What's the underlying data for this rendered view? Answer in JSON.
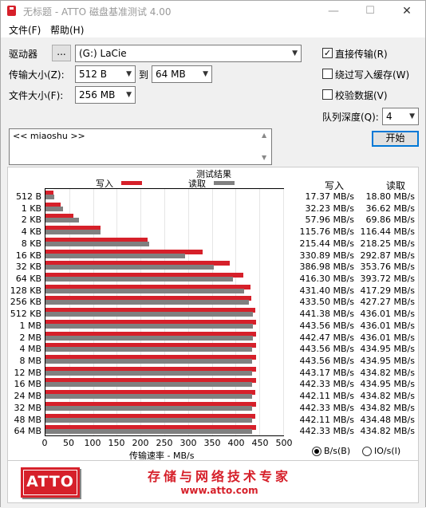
{
  "window": {
    "title": "无标题 - ATTO 磁盘基准测试 4.00",
    "minimize": "—",
    "maximize": "☐",
    "close": "✕"
  },
  "menu": {
    "file": "文件(F)",
    "help": "帮助(H)"
  },
  "controls": {
    "drive_label": "驱动器",
    "browse_label": "...",
    "drive_value": "(G:) LaCie",
    "transfer_label": "传输大小(Z):",
    "transfer_from": "512 B",
    "to_label": "到",
    "transfer_to": "64 MB",
    "filesize_label": "文件大小(F):",
    "filesize_value": "256 MB",
    "direct_io_label": "直接传输(R)",
    "direct_io_checked": true,
    "bypass_cache_label": "绕过写入缓存(W)",
    "bypass_cache_checked": false,
    "verify_label": "校验数据(V)",
    "verify_checked": false,
    "queue_label": "队列深度(Q):",
    "queue_value": "4",
    "start_button": "开始",
    "description": "<< miaoshu >>"
  },
  "results": {
    "section_title": "测试结果",
    "write_legend": "写入",
    "read_legend": "读取",
    "write_header": "写入",
    "read_header": "读取",
    "x_axis_title": "传输速率 - MB/s",
    "unit_bs": "B/s(B)",
    "unit_ios": "IO/s(I)",
    "unit_selected": "B/s(B)",
    "write_color": "#d6202a",
    "read_color": "#808080"
  },
  "chart_data": {
    "type": "bar",
    "orientation": "horizontal",
    "xlabel": "传输速率 - MB/s",
    "xlim": [
      0,
      500
    ],
    "xticks": [
      0,
      50,
      100,
      150,
      200,
      250,
      300,
      350,
      400,
      450,
      500
    ],
    "grid": true,
    "legend": "top",
    "categories": [
      "512 B",
      "1 KB",
      "2 KB",
      "4 KB",
      "8 KB",
      "16 KB",
      "32 KB",
      "64 KB",
      "128 KB",
      "256 KB",
      "512 KB",
      "1 MB",
      "2 MB",
      "4 MB",
      "8 MB",
      "12 MB",
      "16 MB",
      "24 MB",
      "32 MB",
      "48 MB",
      "64 MB"
    ],
    "series": [
      {
        "name": "写入",
        "values": [
          17.37,
          32.23,
          57.96,
          115.76,
          215.44,
          330.89,
          386.98,
          416.3,
          431.4,
          433.5,
          441.38,
          443.56,
          442.47,
          443.56,
          443.56,
          443.17,
          442.33,
          442.11,
          442.33,
          442.11,
          442.33
        ],
        "labels": [
          "17.37 MB/s",
          "32.23 MB/s",
          "57.96 MB/s",
          "115.76 MB/s",
          "215.44 MB/s",
          "330.89 MB/s",
          "386.98 MB/s",
          "416.30 MB/s",
          "431.40 MB/s",
          "433.50 MB/s",
          "441.38 MB/s",
          "443.56 MB/s",
          "442.47 MB/s",
          "443.56 MB/s",
          "443.56 MB/s",
          "443.17 MB/s",
          "442.33 MB/s",
          "442.11 MB/s",
          "442.33 MB/s",
          "442.11 MB/s",
          "442.33 MB/s"
        ]
      },
      {
        "name": "读取",
        "values": [
          18.8,
          36.62,
          69.86,
          116.44,
          218.25,
          292.87,
          353.76,
          393.72,
          417.29,
          427.27,
          436.01,
          436.01,
          436.01,
          434.95,
          434.95,
          434.82,
          434.95,
          434.82,
          434.82,
          434.48,
          434.82
        ],
        "labels": [
          "18.80 MB/s",
          "36.62 MB/s",
          "69.86 MB/s",
          "116.44 MB/s",
          "218.25 MB/s",
          "292.87 MB/s",
          "353.76 MB/s",
          "393.72 MB/s",
          "417.29 MB/s",
          "427.27 MB/s",
          "436.01 MB/s",
          "436.01 MB/s",
          "436.01 MB/s",
          "434.95 MB/s",
          "434.95 MB/s",
          "434.82 MB/s",
          "434.95 MB/s",
          "434.82 MB/s",
          "434.82 MB/s",
          "434.48 MB/s",
          "434.82 MB/s"
        ]
      }
    ]
  },
  "banner": {
    "logo": "ATTO",
    "slogan": "存储与网络技术专家",
    "website": "www.atto.com"
  }
}
